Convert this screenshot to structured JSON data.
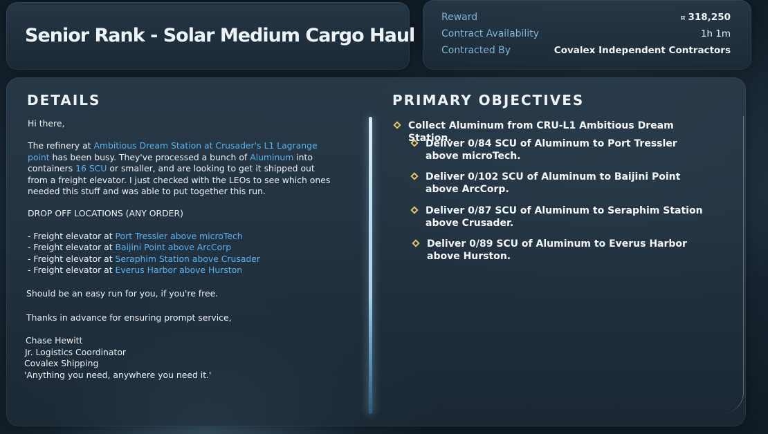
{
  "header": {
    "title": "Senior Rank - Solar Medium Cargo Haul"
  },
  "contract_info": {
    "reward_label": "Reward",
    "reward_currency": "¤",
    "reward_value": "318,250",
    "availability_label": "Contract Availability",
    "availability_value": "1h 1m",
    "contracted_by_label": "Contracted By",
    "contracted_by_value": "Covalex Independent Contractors"
  },
  "details": {
    "heading": "DETAILS",
    "greeting": "Hi there,",
    "intro": {
      "t1": "The refinery at ",
      "h1": "Ambitious Dream Station at Crusader's L1 Lagrange point",
      "t2": " has been busy. They've processed a bunch of ",
      "h2": "Aluminum",
      "t3": " into containers ",
      "h3": "16 SCU",
      "t4": " or smaller, and are looking to get it shipped out from a freight elevator. I just checked with the LEOs to see which ones needed this stuff and was able to put together this run."
    },
    "dropoff_heading": "DROP OFF LOCATIONS (ANY ORDER)",
    "dropoffs": [
      {
        "prefix": "- Freight elevator at ",
        "location": "Port Tressler above microTech"
      },
      {
        "prefix": "- Freight elevator at ",
        "location": "Baijini Point above ArcCorp"
      },
      {
        "prefix": "- Freight elevator at ",
        "location": "Seraphim Station above Crusader"
      },
      {
        "prefix": "- Freight elevator at ",
        "location": "Everus Harbor above Hurston"
      }
    ],
    "easy_run": "Should be an easy run for you, if you're free.",
    "thanks": "Thanks in advance for ensuring prompt service,",
    "signature": {
      "name": "Chase Hewitt",
      "title": "Jr. Logistics Coordinator",
      "company": "Covalex Shipping",
      "motto": "'Anything you need, anywhere you need it.'"
    }
  },
  "objectives": {
    "heading": "PRIMARY OBJECTIVES",
    "main": "Collect Aluminum from CRU-L1 Ambitious Dream Station.",
    "subs": [
      {
        "line1": "Deliver 0/84 SCU of Aluminum to Port Tressler",
        "line2": "above microTech."
      },
      {
        "line1": "Deliver 0/102 SCU of Aluminum to Baijini Point",
        "line2": "above ArcCorp."
      },
      {
        "line1": "Deliver 0/87 SCU of Aluminum to Seraphim Station",
        "line2": "above Crusader."
      },
      {
        "line1": "Deliver 0/89 SCU of Aluminum to Everus Harbor",
        "line2": "above Hurston."
      }
    ]
  },
  "colors": {
    "highlight": "#5cb2ef",
    "label": "#7fb3d8",
    "objective_marker": "#e2c768"
  }
}
